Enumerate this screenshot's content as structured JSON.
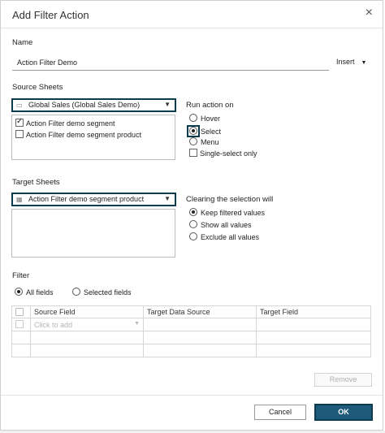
{
  "dialog": {
    "title": "Add Filter Action",
    "close_icon": "close-icon",
    "close_glyph": "×"
  },
  "name_section": {
    "label": "Name",
    "value": "Action Filter Demo",
    "insert_label": "Insert",
    "insert_caret": "▼"
  },
  "source_sheets": {
    "label": "Source Sheets",
    "datasource_icon": "database-icon",
    "selected": "Global Sales (Global Sales Demo)",
    "items": [
      {
        "label": "Action Filter demo segment",
        "checked": true
      },
      {
        "label": "Action Filter demo segment product",
        "checked": false
      }
    ]
  },
  "run_action": {
    "label": "Run action on",
    "options": [
      {
        "label": "Hover",
        "selected": false
      },
      {
        "label": "Select",
        "selected": true
      },
      {
        "label": "Menu",
        "selected": false
      }
    ],
    "single_select_label": "Single-select only",
    "single_select_checked": false
  },
  "target_sheets": {
    "label": "Target Sheets",
    "sheet_icon": "sheet-icon",
    "selected": "Action Filter demo segment product"
  },
  "clearing": {
    "label": "Clearing the selection will",
    "options": [
      {
        "label": "Keep filtered values",
        "selected": true
      },
      {
        "label": "Show all values",
        "selected": false
      },
      {
        "label": "Exclude all values",
        "selected": false
      }
    ]
  },
  "filter": {
    "label": "Filter",
    "all_fields_label": "All fields",
    "selected_fields_label": "Selected fields",
    "all_fields_selected": true,
    "columns": [
      "Source Field",
      "Target Data Source",
      "Target Field"
    ],
    "add_placeholder": "Click to add"
  },
  "buttons": {
    "remove": "Remove",
    "cancel": "Cancel",
    "ok": "OK"
  },
  "colors": {
    "accent": "#1e5b7a",
    "focus_border": "#0b3b4d"
  }
}
